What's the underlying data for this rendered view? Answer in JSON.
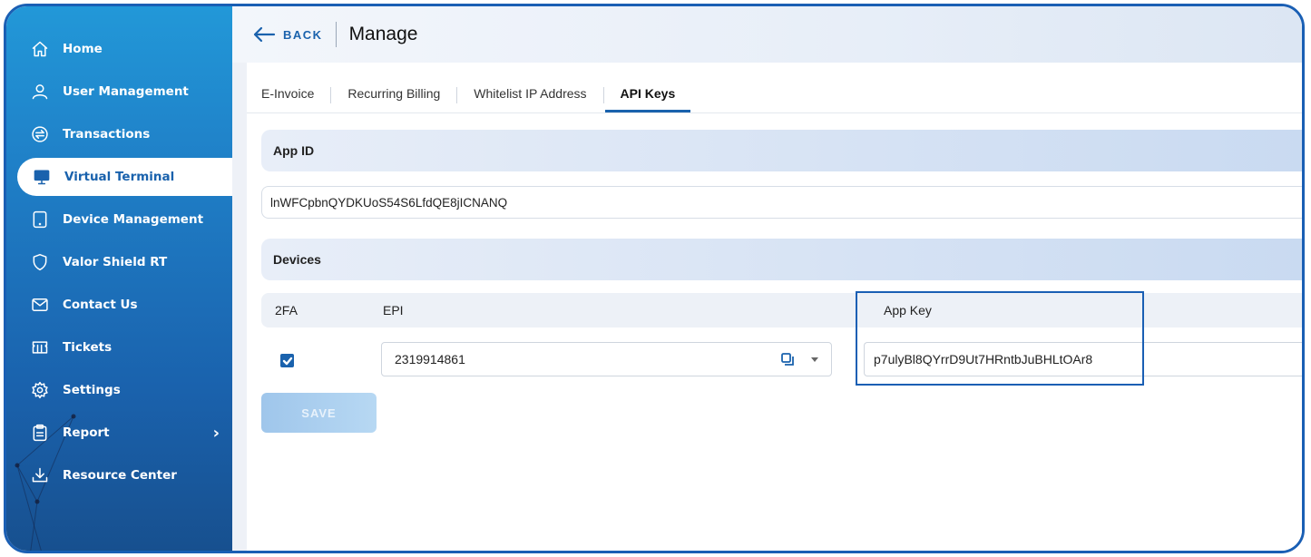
{
  "sidebar": {
    "items": [
      {
        "label": "Home",
        "icon": "home-icon"
      },
      {
        "label": "User Management",
        "icon": "user-icon"
      },
      {
        "label": "Transactions",
        "icon": "transfer-icon"
      },
      {
        "label": "Virtual Terminal",
        "icon": "monitor-icon"
      },
      {
        "label": "Device Management",
        "icon": "tablet-icon"
      },
      {
        "label": "Valor Shield RT",
        "icon": "shield-icon"
      },
      {
        "label": "Contact Us",
        "icon": "mail-icon"
      },
      {
        "label": "Tickets",
        "icon": "ticket-icon"
      },
      {
        "label": "Settings",
        "icon": "gear-icon"
      },
      {
        "label": "Report",
        "icon": "clipboard-icon"
      },
      {
        "label": "Resource Center",
        "icon": "download-icon"
      }
    ],
    "active": "Virtual Terminal",
    "report_chevron": "›"
  },
  "header": {
    "back_label": "BACK",
    "title": "Manage"
  },
  "tabs": [
    {
      "label": "E-Invoice"
    },
    {
      "label": "Recurring Billing"
    },
    {
      "label": "Whitelist IP Address"
    },
    {
      "label": "API Keys"
    }
  ],
  "app_id": {
    "label": "App ID",
    "value": "lnWFCpbnQYDKUoS54S6LfdQE8jICNANQ"
  },
  "devices": {
    "label": "Devices",
    "columns": {
      "twofa": "2FA",
      "epi": "EPI",
      "app_key": "App Key"
    },
    "row": {
      "twofa_checked": true,
      "epi": "2319914861",
      "app_key": "p7ulyBl8QYrrD9Ut7HRntbJuBHLtOAr8"
    }
  },
  "save_label": "SAVE",
  "colors": {
    "accent": "#1a62ad",
    "sidebar_top": "#2298d8",
    "sidebar_bottom": "#17508f"
  }
}
